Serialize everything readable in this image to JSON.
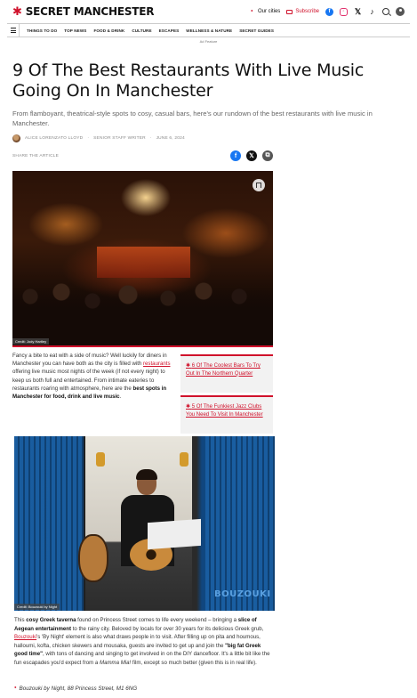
{
  "header": {
    "logo_text": "SECRET MANCHESTER",
    "our_cities": "Our cities",
    "subscribe": "Subscribe",
    "accent_color": "#d0112b"
  },
  "nav": {
    "items": [
      "THINGS TO DO",
      "TOP NEWS",
      "FOOD & DRINK",
      "CULTURE",
      "ESCAPES",
      "WELLNESS & NATURE",
      "SECRET GUIDES"
    ]
  },
  "ad_label": "Ad Feature",
  "article": {
    "headline": "9 Of The Best Restaurants With Live Music Going On In Manchester",
    "standfirst": "From flamboyant, theatrical-style spots to cosy, casual bars, here's our rundown of the best restaurants with live music in Manchester.",
    "author": "ALICE LORENZATO LLOYD",
    "author_role": "SENIOR STAFF WRITER",
    "date": "JUNE 6, 2024",
    "share_label": "SHARE THE ARTICLE",
    "image1_credit": "Credit: Jody Hartley",
    "intro": {
      "p1": "Fancy a bite to eat with a side of music? Well luckily for diners in Manchester you can have both as the city is filled with ",
      "link": "restaurants",
      "p2": " offering live music most nights of the week (if not every night) to keep us both full and entertained. From intimate eateries to restaurants roaring with atmosphere, here are the ",
      "bold": "best spots in Manchester for food, drink and live music",
      "p3": "."
    },
    "related": [
      "6 Of The Coolest Bars To Try Out In The Northern Quarter",
      "5 Of The Funkiest Jazz Clubs You Need To Visit In Manchester"
    ],
    "image2_credit": "Credit: Bouzouki by Night",
    "image2_logo": "BOUZOUKI",
    "section1": {
      "t1": "This ",
      "b1": "cosy Greek taverna",
      "t2": " found on Princess Street comes to life every weekend – bringing a ",
      "b2": "slice of Aegean entertainment",
      "t3": " to the rainy city. Beloved by locals for over 30 years for its delicious Greek grub, ",
      "link": "Bouzouki",
      "t4": "'s 'By Night' element is also what draws people in to visit. After filling up on pita and houmous, halloumi, kofta, chicken skewers and mousaka, guests are invited to get up and join the ",
      "b3": "\"big fat Greek good time\"",
      "t5": ", with tons of dancing and singing to get involved in on the DIY dancefloor. It's a little bit like the fun escapades you'd expect from a ",
      "i1": "Mamma Mia!",
      "t6": " film, except so much better (given this is in real life)."
    },
    "address": "Bouzouki by Night, 88 Princess Street, M1 6NG"
  }
}
